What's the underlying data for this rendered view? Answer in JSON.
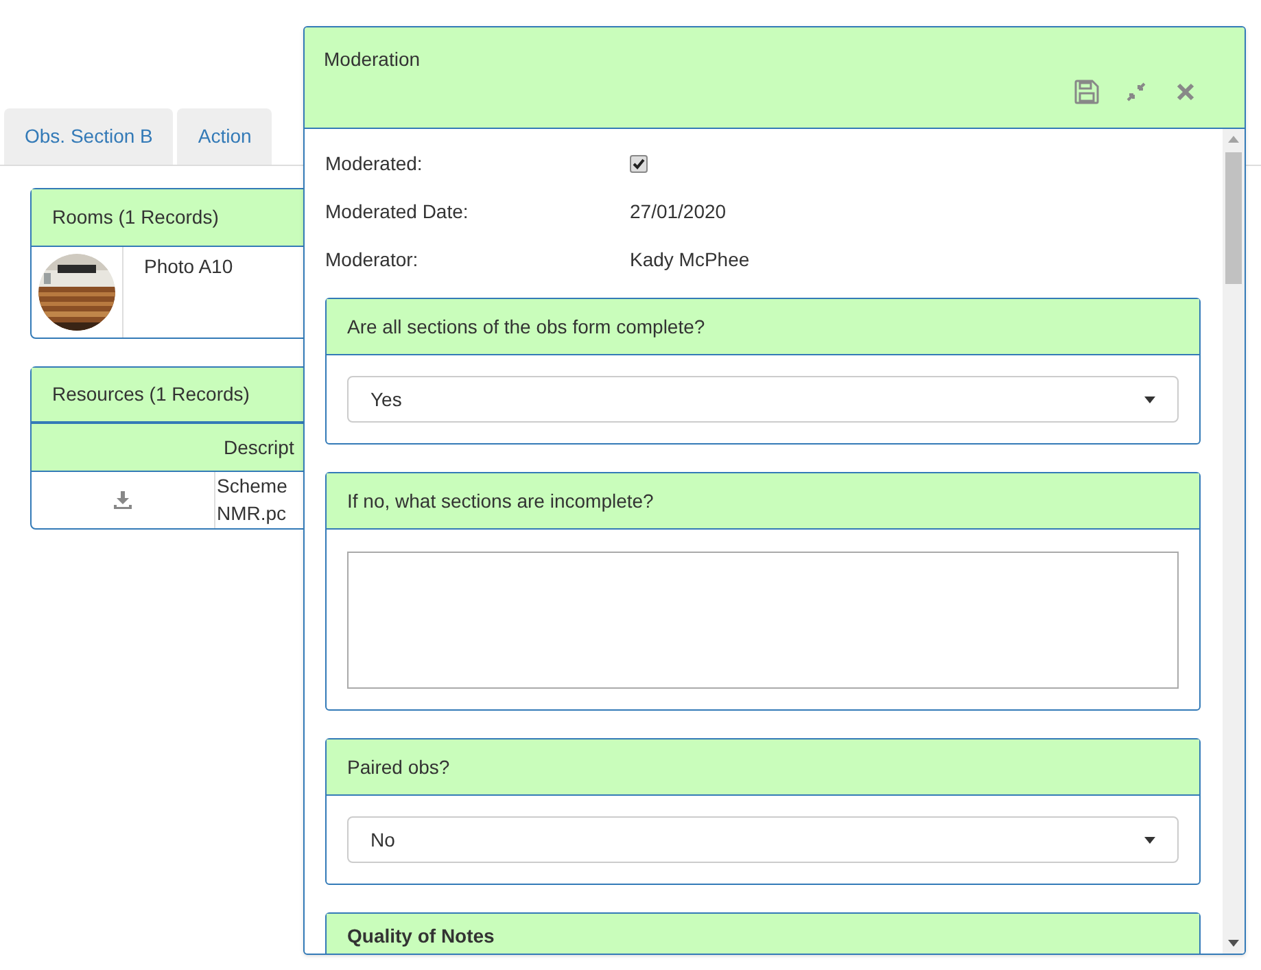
{
  "tabs": [
    {
      "label": "Obs. Section B",
      "selected": false
    },
    {
      "label": "Action",
      "selected": false
    }
  ],
  "rooms": {
    "title": "Rooms (1 Records)",
    "rows": [
      {
        "name": "Photo A10"
      }
    ]
  },
  "resources": {
    "title": "Resources (1 Records)",
    "columns": [
      "Descript"
    ],
    "rows": [
      {
        "description": "Scheme\nNMR.pc"
      }
    ]
  },
  "modal": {
    "title": "Moderation",
    "fields": [
      {
        "label": "Moderated:",
        "kind": "checkbox",
        "checked": true
      },
      {
        "label": "Moderated Date:",
        "kind": "text",
        "value": "27/01/2020"
      },
      {
        "label": "Moderator:",
        "kind": "text",
        "value": "Kady McPhee"
      }
    ],
    "sections": [
      {
        "title": "Are all sections of the obs form complete?",
        "kind": "select",
        "value": "Yes"
      },
      {
        "title": "If no, what sections are incomplete?",
        "kind": "textarea"
      },
      {
        "title": "Paired obs?",
        "kind": "select",
        "value": "No"
      },
      {
        "title": "Quality of Notes",
        "kind": "heading"
      }
    ]
  }
}
